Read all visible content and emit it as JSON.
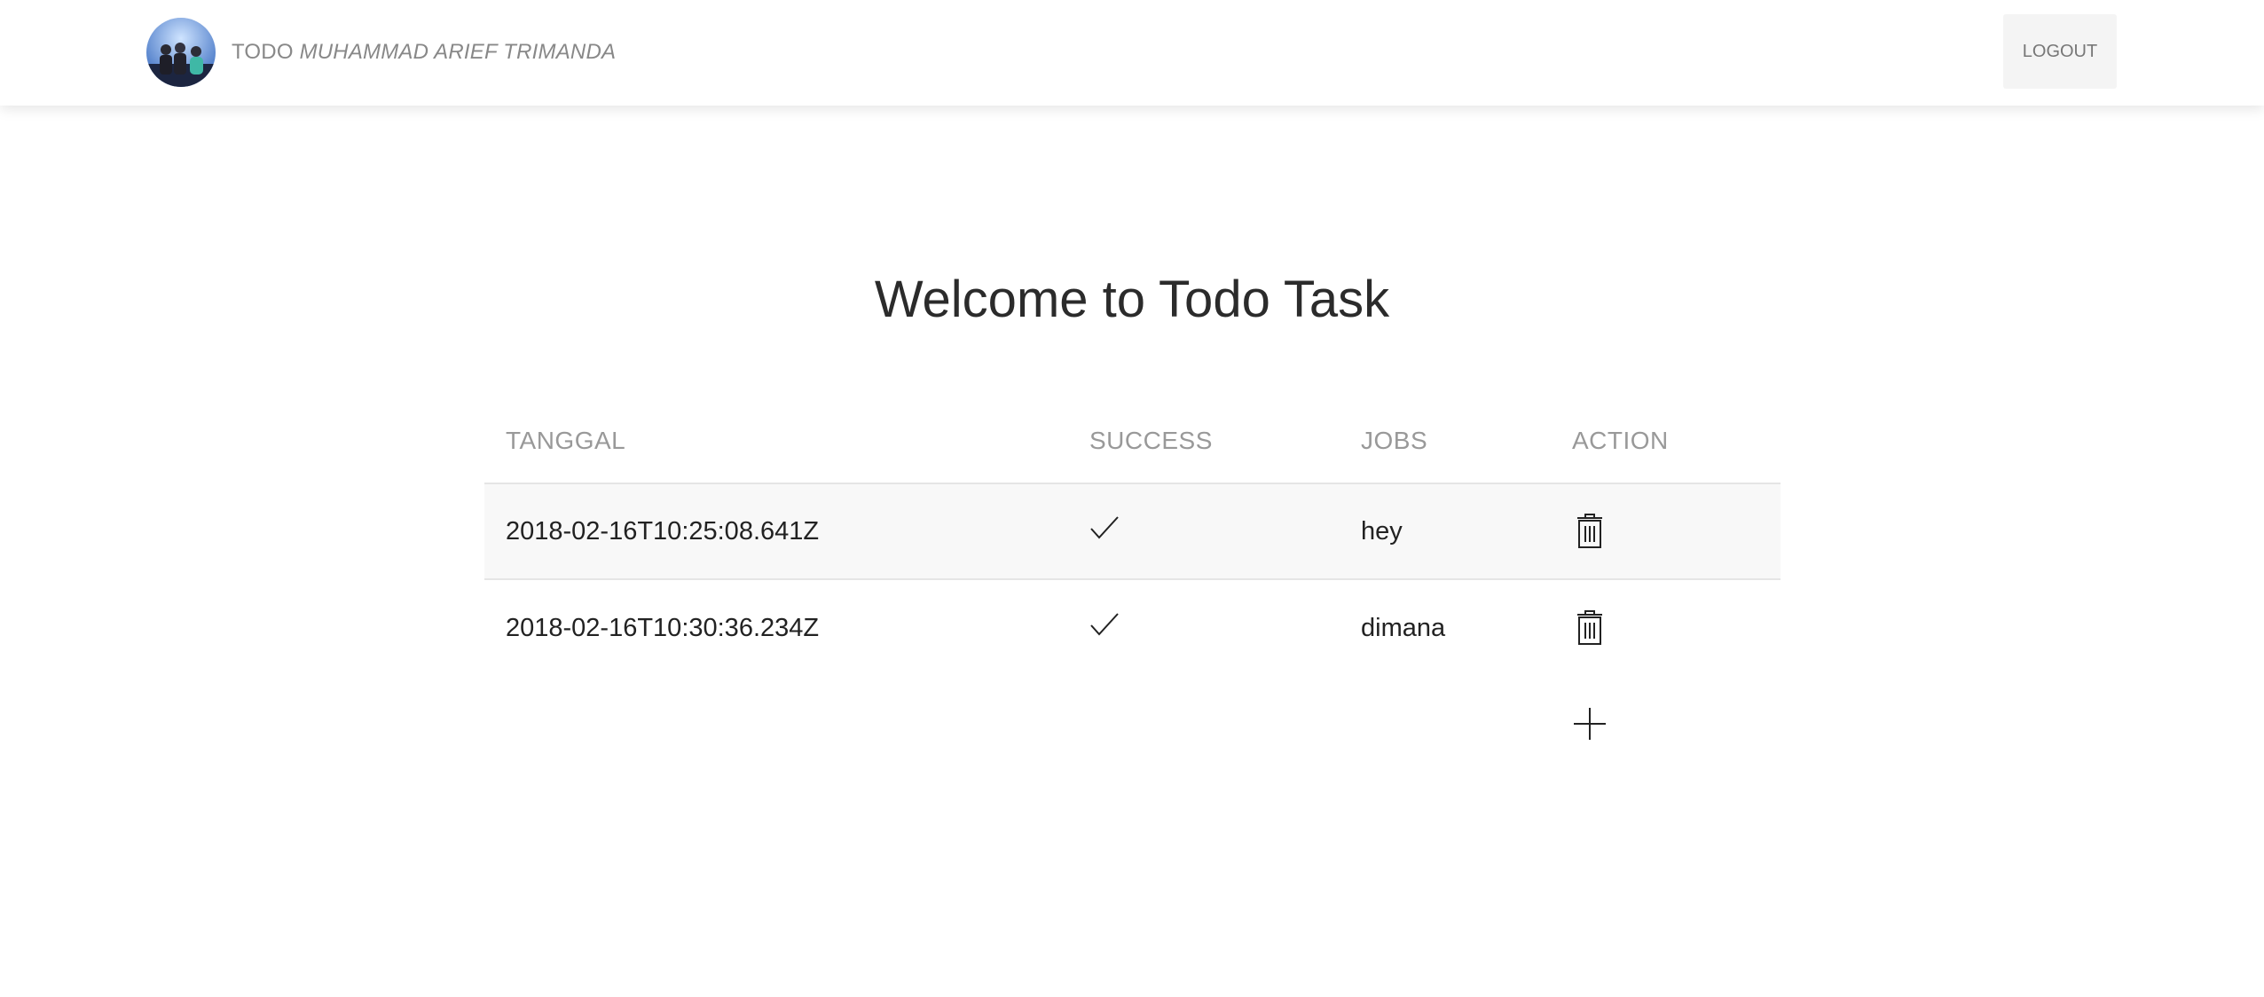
{
  "navbar": {
    "brand_prefix": "TODO",
    "brand_name": "MUHAMMAD ARIEF TRIMANDA",
    "logout_label": "LOGOUT"
  },
  "main": {
    "title": "Welcome to Todo Task"
  },
  "table": {
    "headers": [
      "TANGGAL",
      "SUCCESS",
      "JOBS",
      "ACTION"
    ],
    "rows": [
      {
        "tanggal": "2018-02-16T10:25:08.641Z",
        "success": "check-icon",
        "jobs": "hey",
        "action": "trash-icon"
      },
      {
        "tanggal": "2018-02-16T10:30:36.234Z",
        "success": "check-icon",
        "jobs": "dimana",
        "action": "trash-icon"
      }
    ],
    "add_icon": "plus-icon"
  },
  "colors": {
    "header_text": "#999999",
    "body_text": "#222222",
    "stripe": "#f8f8f8",
    "logout_bg": "#f4f4f4"
  }
}
